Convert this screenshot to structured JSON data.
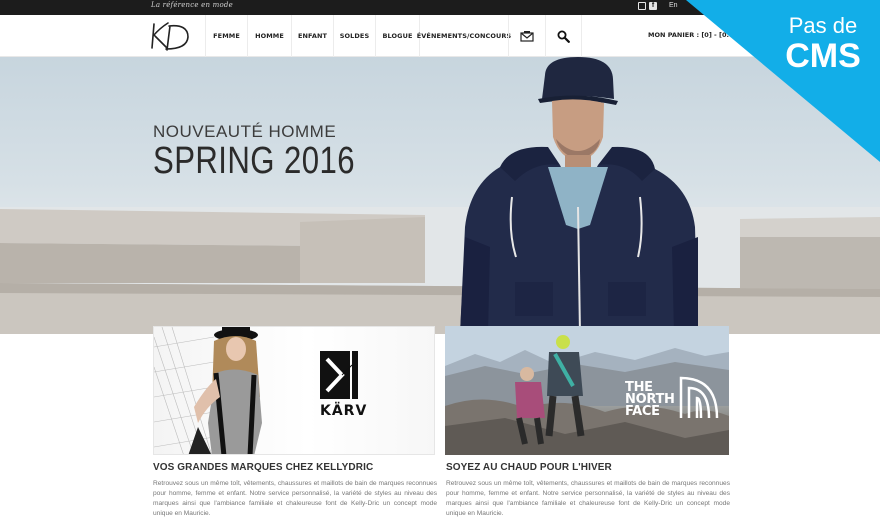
{
  "topbar": {
    "tagline": "La référence en mode",
    "language": "En"
  },
  "header": {
    "logo_text": "KD",
    "nav": [
      {
        "label": "FEMME"
      },
      {
        "label": "HOMME"
      },
      {
        "label": "ENFANT"
      },
      {
        "label": "SOLDES"
      },
      {
        "label": "BLOGUE"
      },
      {
        "label": "ÉVÉNEMENTS/CONCOURS"
      }
    ],
    "cart_label": "MON PANIER : [0] - [0.00$]"
  },
  "ribbon": {
    "line1": "Pas de",
    "line2": "CMS"
  },
  "hero": {
    "subtitle": "NOUVEAUTÉ HOMME",
    "title": "SPRING 2016"
  },
  "panels": {
    "left_brand": "KÄRV",
    "right_brand_line1": "THE",
    "right_brand_line2": "NORTH",
    "right_brand_line3": "FACE"
  },
  "sections": [
    {
      "title": "VOS GRANDES MARQUES CHEZ KELLYDRIC",
      "text": "Retrouvez sous un même toît, vêtements, chaussures et maillots de bain de marques reconnues pour homme, femme et enfant. Notre service personnalisé, la variété de styles au niveau des marques ainsi que l'ambiance familiale et chaleureuse font de Kelly-Dric un concept mode unique en Mauricie."
    },
    {
      "title": "SOYEZ AU CHAUD POUR L'HIVER",
      "text": "Retrouvez sous un même toît, vêtements, chaussures et maillots de bain de marques reconnues pour homme, femme et enfant. Notre service personnalisé, la variété de styles au niveau des marques ainsi que l'ambiance familiale et chaleureuse font de Kelly-Dric un concept mode unique en Mauricie."
    }
  ],
  "colors": {
    "accent": "#12aee8",
    "topbar": "#1c1c1c"
  }
}
